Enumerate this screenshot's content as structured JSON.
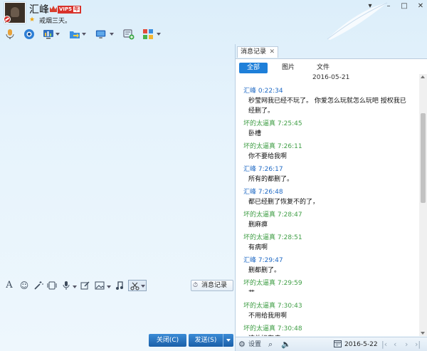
{
  "header": {
    "name": "汇峰",
    "vip_label": "VIP5",
    "vip_year": "年",
    "status": "戒烟三天。"
  },
  "window_controls": {
    "skin": "▾",
    "minimize": "–",
    "maximize": "□",
    "close": "✕"
  },
  "toolbar": {
    "icons": [
      "microphone-icon",
      "video-camera-icon",
      "screen-share-icon",
      "file-transfer-icon",
      "remote-desktop-icon",
      "add-app-icon",
      "apps-grid-icon"
    ]
  },
  "format_bar": {
    "font_glyph": "A",
    "emoji_glyph": "☺",
    "record_label": "消息记录"
  },
  "buttons": {
    "close": "关闭(C)",
    "send": "发送(S)"
  },
  "history": {
    "tab_label": "消息记录",
    "tab_close": "✕",
    "filters": [
      "全部",
      "图片",
      "文件"
    ],
    "active_filter": "全部",
    "date_header": "2016-05-21",
    "messages": [
      {
        "sender": "汇峰",
        "time": "0:22:34",
        "self": true,
        "text": "秒莹网我已经不玩了。   你爱怎么玩就怎么玩吧   授权我已经删了。"
      },
      {
        "sender": "坏的太逼真",
        "time": "7:25:45",
        "self": false,
        "text": "卧槽"
      },
      {
        "sender": "坏的太逼真",
        "time": "7:26:11",
        "self": false,
        "text": "你不要给我啊"
      },
      {
        "sender": "汇峰",
        "time": "7:26:17",
        "self": true,
        "text": "所有的都删了。"
      },
      {
        "sender": "汇峰",
        "time": "7:26:48",
        "self": true,
        "text": "都已经删了恢复不的了，"
      },
      {
        "sender": "坏的太逼真",
        "time": "7:28:47",
        "self": false,
        "text": "删麻痹"
      },
      {
        "sender": "坏的太逼真",
        "time": "7:28:51",
        "self": false,
        "text": "有病啊"
      },
      {
        "sender": "汇峰",
        "time": "7:29:47",
        "self": true,
        "text": "删都删了。"
      },
      {
        "sender": "坏的太逼真",
        "time": "7:29:59",
        "self": false,
        "text": "艹"
      },
      {
        "sender": "坏的太逼真",
        "time": "7:30:43",
        "self": false,
        "text": "不用给我用啊"
      },
      {
        "sender": "坏的太逼真",
        "time": "7:30:48",
        "self": false,
        "text": "这他妈有病"
      }
    ],
    "settings_label": "设置",
    "footer_date": "2016-5-22"
  },
  "colors": {
    "self": "#1f69c4",
    "other": "#3f9e45",
    "accent": "#1e7fd9"
  }
}
